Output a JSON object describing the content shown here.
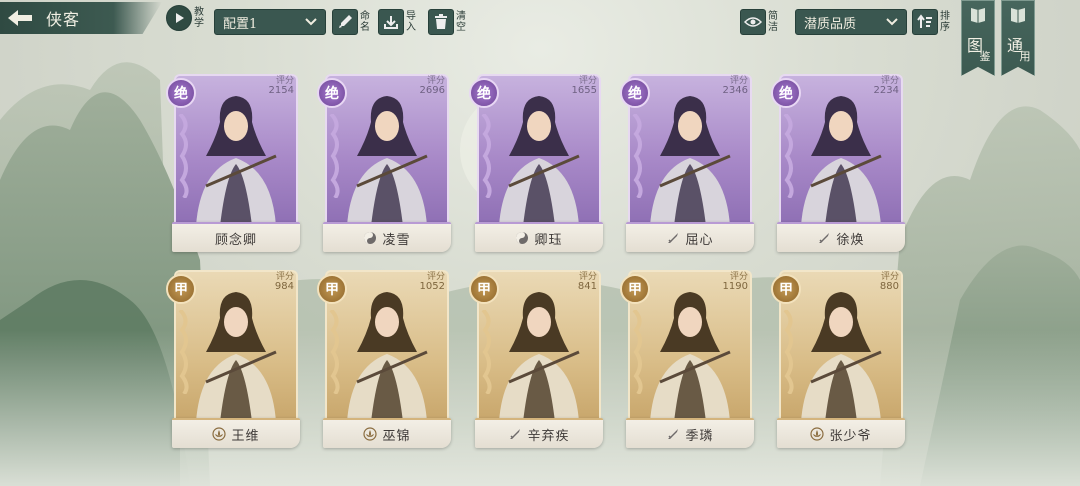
{
  "header": {
    "title": "侠客",
    "tutorial_label": "教学"
  },
  "toolbar": {
    "preset_value": "配置1",
    "rename_label": "命名",
    "import_label": "导入",
    "clear_label": "清空",
    "simple_label": "简洁",
    "quality_filter_value": "潜质品质",
    "sort_label": "排序"
  },
  "side_tabs": [
    {
      "big": "图",
      "small": "鉴"
    },
    {
      "big": "通",
      "small": "用"
    }
  ],
  "cards": [
    {
      "rank": "绝",
      "score_label": "评分",
      "score": "2154",
      "name": "顾念卿",
      "school_icon": "none",
      "tier": "jue"
    },
    {
      "rank": "绝",
      "score_label": "评分",
      "score": "2696",
      "name": "凌雪",
      "school_icon": "taiji-icon",
      "tier": "jue"
    },
    {
      "rank": "绝",
      "score_label": "评分",
      "score": "1655",
      "name": "卿珏",
      "school_icon": "taiji-icon",
      "tier": "jue"
    },
    {
      "rank": "绝",
      "score_label": "评分",
      "score": "2346",
      "name": "屈心",
      "school_icon": "sword-icon",
      "tier": "jue"
    },
    {
      "rank": "绝",
      "score_label": "评分",
      "score": "2234",
      "name": "徐焕",
      "school_icon": "sword-icon",
      "tier": "jue"
    },
    {
      "rank": "甲",
      "score_label": "评分",
      "score": "984",
      "name": "王维",
      "school_icon": "lotus-icon",
      "tier": "jia"
    },
    {
      "rank": "甲",
      "score_label": "评分",
      "score": "1052",
      "name": "巫锦",
      "school_icon": "lotus-icon",
      "tier": "jia"
    },
    {
      "rank": "甲",
      "score_label": "评分",
      "score": "841",
      "name": "辛弃疾",
      "school_icon": "sword-icon",
      "tier": "jia"
    },
    {
      "rank": "甲",
      "score_label": "评分",
      "score": "1190",
      "name": "季璘",
      "school_icon": "sword-icon",
      "tier": "jia"
    },
    {
      "rank": "甲",
      "score_label": "评分",
      "score": "880",
      "name": "张少爷",
      "school_icon": "lotus-icon",
      "tier": "jia"
    }
  ],
  "colors": {
    "jue_tier": "#8e6fb4",
    "jia_tier": "#c8a66b",
    "toolbar": "#3a5750"
  }
}
